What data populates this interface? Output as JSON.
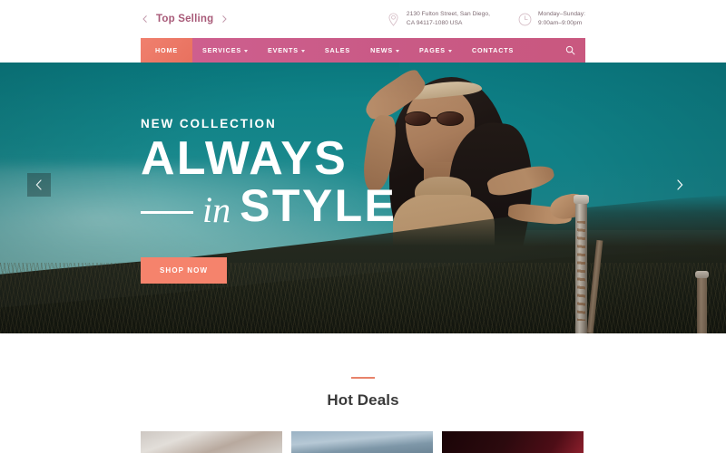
{
  "topbar": {
    "top_selling": {
      "label": "Top Selling",
      "prev_icon": "chevron-left-icon",
      "next_icon": "chevron-right-icon"
    },
    "address": {
      "icon": "map-pin-icon",
      "line1": "2130 Fulton Street, San Diego,",
      "line2": "CA 94117-1080 USA"
    },
    "hours": {
      "icon": "clock-icon",
      "line1": "Monday–Sunday:",
      "line2": "9:00am–9:00pm"
    }
  },
  "nav": {
    "items": [
      {
        "label": "HOME",
        "has_dropdown": false,
        "active": true
      },
      {
        "label": "SERVICES",
        "has_dropdown": true,
        "active": false
      },
      {
        "label": "EVENTS",
        "has_dropdown": true,
        "active": false
      },
      {
        "label": "SALES",
        "has_dropdown": false,
        "active": false
      },
      {
        "label": "NEWS",
        "has_dropdown": true,
        "active": false
      },
      {
        "label": "PAGES",
        "has_dropdown": true,
        "active": false
      },
      {
        "label": "CONTACTS",
        "has_dropdown": false,
        "active": false
      }
    ],
    "search_icon": "search-icon",
    "bar_color": "#c95a86",
    "active_color": "#ec765f"
  },
  "hero": {
    "eyebrow": "NEW COLLECTION",
    "headline_line1": "ALWAYS",
    "headline_italic": "in",
    "headline_line2": "STYLE",
    "cta_label": "SHOP NOW",
    "cta_color": "#f5836c",
    "prev_arrow_icon": "chevron-left-icon",
    "next_arrow_icon": "chevron-right-icon"
  },
  "deals": {
    "title": "Hot Deals",
    "divider_color": "#e8836a",
    "cards": [
      {
        "name": "product-card-1"
      },
      {
        "name": "product-card-2"
      },
      {
        "name": "product-card-3"
      }
    ]
  }
}
